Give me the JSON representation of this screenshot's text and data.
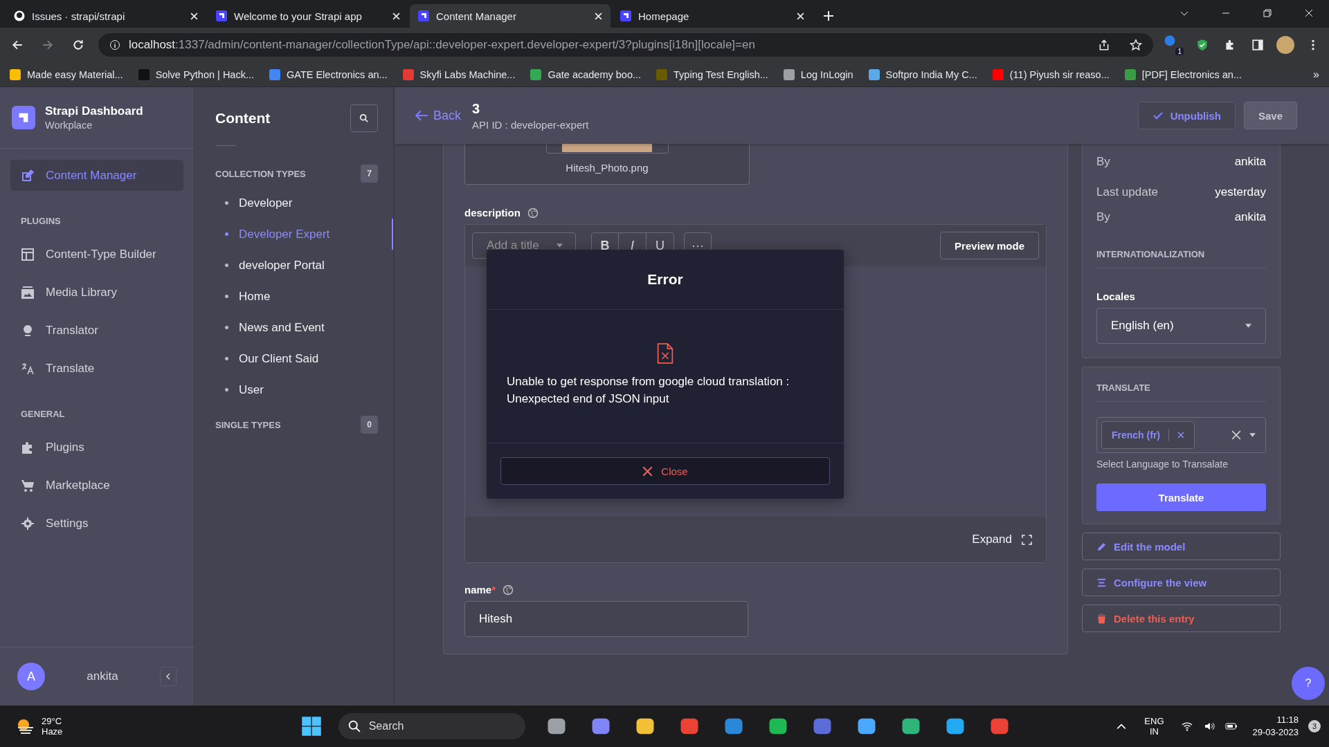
{
  "browser": {
    "tabs": [
      {
        "title": "Issues · strapi/strapi",
        "selected": false
      },
      {
        "title": "Welcome to your Strapi app",
        "selected": false
      },
      {
        "title": "Content Manager",
        "selected": true
      },
      {
        "title": "Homepage",
        "selected": false
      }
    ],
    "address": {
      "host": "localhost",
      "rest": ":1337/admin/content-manager/collectionType/api::developer-expert.developer-expert/3?plugins[i18n][locale]=en"
    },
    "extension_badge": "1",
    "bookmarks": [
      "Made easy Material...",
      "Solve Python | Hack...",
      "GATE Electronics an...",
      "Skyfi Labs Machine...",
      "Gate academy boo...",
      "Typing Test English...",
      "Log InLogin",
      "Softpro India My C...",
      "(11) Piyush sir reaso...",
      "[PDF] Electronics an..."
    ],
    "bookmarks_overflow": "»"
  },
  "sidebar": {
    "brand": {
      "title": "Strapi Dashboard",
      "subtitle": "Workplace"
    },
    "groups": [
      {
        "items": [
          {
            "label": "Content Manager",
            "selected": true
          }
        ]
      },
      {
        "heading": "PLUGINS",
        "items": [
          {
            "label": "Content-Type Builder",
            "selected": false
          },
          {
            "label": "Media Library",
            "selected": false
          },
          {
            "label": "Translator",
            "selected": false
          },
          {
            "label": "Translate",
            "selected": false
          }
        ]
      },
      {
        "heading": "GENERAL",
        "items": [
          {
            "label": "Plugins",
            "selected": false
          },
          {
            "label": "Marketplace",
            "selected": false
          },
          {
            "label": "Settings",
            "selected": false
          }
        ]
      }
    ],
    "user": {
      "initial": "A",
      "name": "ankita"
    }
  },
  "content_nav": {
    "title": "Content",
    "groups": [
      {
        "heading": "COLLECTION TYPES",
        "count": "7",
        "items": [
          {
            "label": "Developer",
            "selected": false
          },
          {
            "label": "Developer Expert",
            "selected": true
          },
          {
            "label": "developer Portal",
            "selected": false
          },
          {
            "label": "Home",
            "selected": false
          },
          {
            "label": "News and Event",
            "selected": false
          },
          {
            "label": "Our Client Said",
            "selected": false
          },
          {
            "label": "User",
            "selected": false
          }
        ]
      },
      {
        "heading": "SINGLE TYPES",
        "count": "0"
      }
    ]
  },
  "header": {
    "back": "Back",
    "title": "3",
    "subtitle": "API ID : developer-expert",
    "unpublish": "Unpublish",
    "save": "Save"
  },
  "form": {
    "media": {
      "filename": "Hitesh_Photo.png"
    },
    "description": {
      "label": "description",
      "heading_select": "Add a title",
      "bold": "B",
      "italic": "I",
      "underline": "U",
      "more": "···",
      "preview": "Preview mode",
      "expand": "Expand"
    },
    "name": {
      "label": "name",
      "required_mark": "*",
      "value": "Hitesh"
    }
  },
  "modal": {
    "title": "Error",
    "message": "Unable to get response from google cloud translation : Unexpected end of JSON input",
    "close": "Close"
  },
  "info": {
    "rows": [
      {
        "label": "By",
        "value": "ankita"
      },
      {
        "label": "Last update",
        "value": "yesterday"
      },
      {
        "label": "By",
        "value": "ankita"
      }
    ],
    "i18n_heading": "INTERNATIONALIZATION",
    "locales_label": "Locales",
    "locale": "English (en)"
  },
  "translate": {
    "heading": "TRANSLATE",
    "chip": "French (fr)",
    "hint": "Select Language to Transalate",
    "button": "Translate"
  },
  "actions": [
    {
      "label": "Edit the model",
      "kind": "edit"
    },
    {
      "label": "Configure the view",
      "kind": "configure"
    },
    {
      "label": "Delete this entry",
      "kind": "delete"
    }
  ],
  "help": "?",
  "taskbar": {
    "weather": {
      "temp": "29°C",
      "desc": "Haze"
    },
    "search": "Search",
    "lang": "ENG",
    "region": "IN",
    "time": "11:18",
    "date": "29-03-2023",
    "notifications": "3"
  }
}
